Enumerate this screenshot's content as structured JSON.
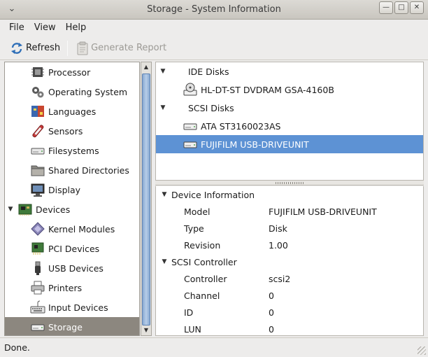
{
  "window": {
    "title": "Storage - System Information",
    "controls": [
      "minimize",
      "maximize",
      "close"
    ]
  },
  "menubar": {
    "items": [
      "File",
      "View",
      "Help"
    ]
  },
  "toolbar": {
    "refresh_label": "Refresh",
    "report_label": "Generate Report"
  },
  "sidebar": {
    "items": [
      {
        "label": "Processor",
        "icon": "processor-icon",
        "level": 1
      },
      {
        "label": "Operating System",
        "icon": "gears-icon",
        "level": 1
      },
      {
        "label": "Languages",
        "icon": "languages-icon",
        "level": 1
      },
      {
        "label": "Sensors",
        "icon": "sensors-icon",
        "level": 1
      },
      {
        "label": "Filesystems",
        "icon": "filesystem-icon",
        "level": 1
      },
      {
        "label": "Shared Directories",
        "icon": "folder-icon",
        "level": 1
      },
      {
        "label": "Display",
        "icon": "display-icon",
        "level": 1
      },
      {
        "label": "Devices",
        "icon": "devices-icon",
        "level": 0,
        "expanded": true
      },
      {
        "label": "Kernel Modules",
        "icon": "kernel-modules-icon",
        "level": 1
      },
      {
        "label": "PCI Devices",
        "icon": "pci-icon",
        "level": 1
      },
      {
        "label": "USB Devices",
        "icon": "usb-icon",
        "level": 1
      },
      {
        "label": "Printers",
        "icon": "printer-icon",
        "level": 1
      },
      {
        "label": "Input Devices",
        "icon": "keyboard-icon",
        "level": 1
      },
      {
        "label": "Storage",
        "icon": "hard-disk-icon",
        "level": 1,
        "selected": true
      }
    ]
  },
  "devices": {
    "groups": [
      {
        "label": "IDE Disks",
        "items": [
          {
            "label": "HL-DT-ST DVDRAM GSA-4160B",
            "icon": "optical-drive-icon"
          }
        ]
      },
      {
        "label": "SCSI Disks",
        "items": [
          {
            "label": "ATA ST3160023AS",
            "icon": "hard-disk-icon"
          },
          {
            "label": "FUJIFILM USB-DRIVEUNIT",
            "icon": "hard-disk-icon",
            "selected": true
          }
        ]
      }
    ]
  },
  "details": {
    "sections": [
      {
        "title": "Device Information",
        "rows": [
          {
            "key": "Model",
            "value": "FUJIFILM USB-DRIVEUNIT"
          },
          {
            "key": "Type",
            "value": "Disk"
          },
          {
            "key": "Revision",
            "value": "1.00"
          }
        ]
      },
      {
        "title": "SCSI Controller",
        "rows": [
          {
            "key": "Controller",
            "value": "scsi2"
          },
          {
            "key": "Channel",
            "value": "0"
          },
          {
            "key": "ID",
            "value": "0"
          },
          {
            "key": "LUN",
            "value": "0"
          }
        ]
      }
    ]
  },
  "status": {
    "text": "Done."
  },
  "colors": {
    "selection_blue": "#5d92d4",
    "sidebar_selection": "#8c877f",
    "scrollbar_thumb": "#88a9d2"
  }
}
